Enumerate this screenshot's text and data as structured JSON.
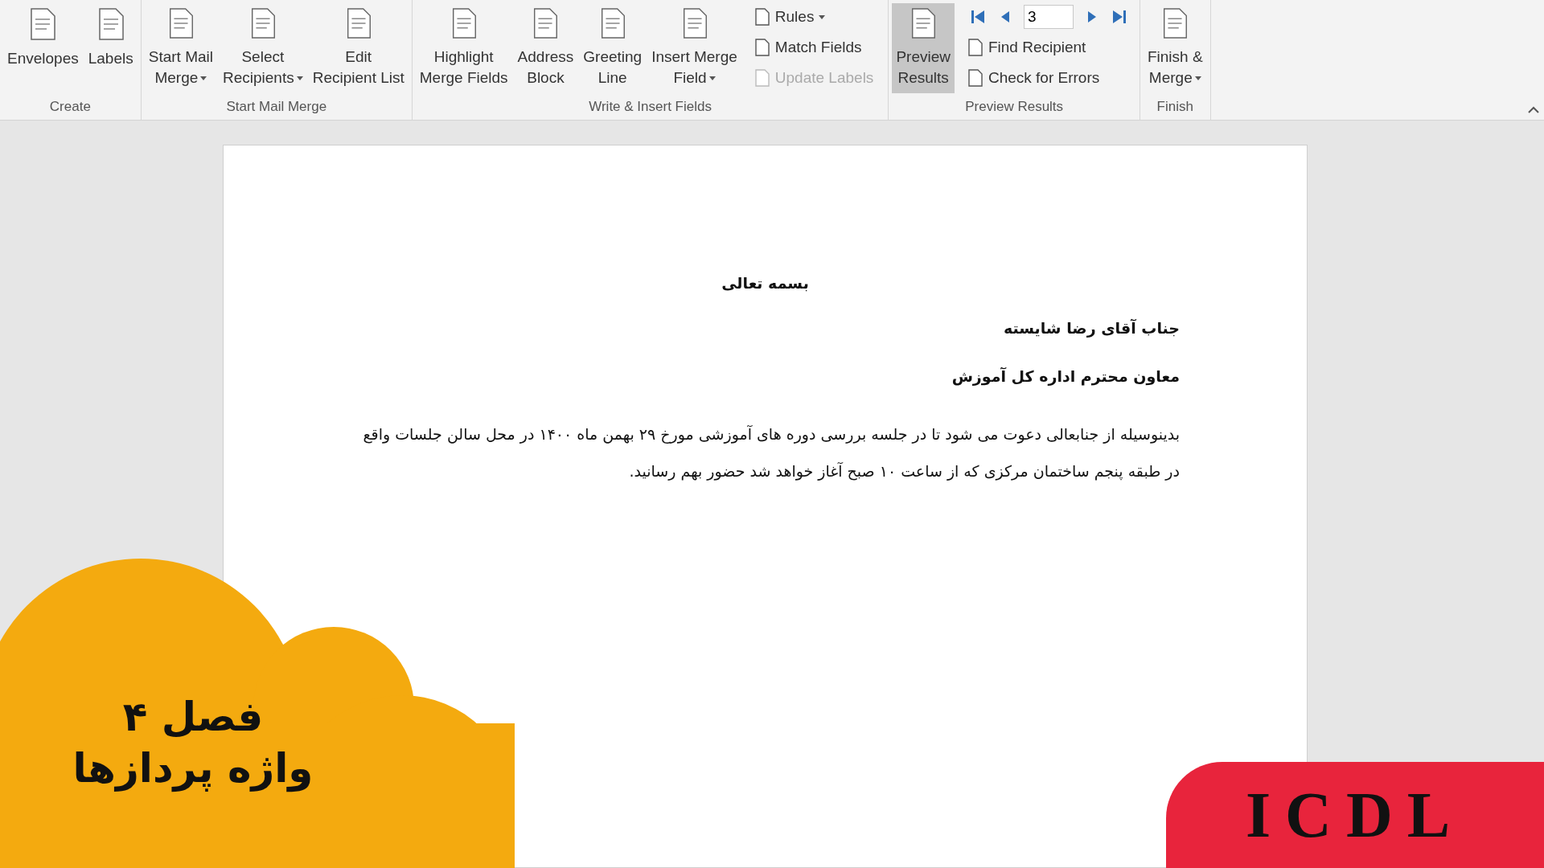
{
  "ribbon": {
    "groups": [
      {
        "label": "Create",
        "items": [
          {
            "kind": "large",
            "lines": [
              "Envelopes"
            ],
            "dropdown": false,
            "on": false
          },
          {
            "kind": "large",
            "lines": [
              "Labels"
            ],
            "dropdown": false,
            "on": false
          }
        ]
      },
      {
        "label": "Start Mail Merge",
        "items": [
          {
            "kind": "large",
            "lines": [
              "Start Mail",
              "Merge"
            ],
            "dropdown": true,
            "on": false
          },
          {
            "kind": "large",
            "lines": [
              "Select",
              "Recipients"
            ],
            "dropdown": true,
            "on": false
          },
          {
            "kind": "large",
            "lines": [
              "Edit",
              "Recipient List"
            ],
            "dropdown": false,
            "on": false
          }
        ]
      },
      {
        "label": "Write & Insert Fields",
        "items": [
          {
            "kind": "large",
            "lines": [
              "Highlight",
              "Merge Fields"
            ],
            "dropdown": false,
            "on": false
          },
          {
            "kind": "large",
            "lines": [
              "Address",
              "Block"
            ],
            "dropdown": false,
            "on": false
          },
          {
            "kind": "large",
            "lines": [
              "Greeting",
              "Line"
            ],
            "dropdown": false,
            "on": false
          },
          {
            "kind": "large",
            "lines": [
              "Insert Merge",
              "Field"
            ],
            "dropdown": true,
            "on": false
          },
          {
            "kind": "stack",
            "rows": [
              {
                "kind": "small",
                "label": "Rules",
                "dropdown": true,
                "disabled": false
              },
              {
                "kind": "small",
                "label": "Match Fields",
                "dropdown": false,
                "disabled": false
              },
              {
                "kind": "small",
                "label": "Update Labels",
                "dropdown": false,
                "disabled": true
              }
            ]
          }
        ]
      },
      {
        "label": "Preview Results",
        "items": [
          {
            "kind": "large",
            "lines": [
              "Preview",
              "Results"
            ],
            "dropdown": false,
            "on": true
          },
          {
            "kind": "stack",
            "rows": [
              {
                "kind": "nav",
                "value": "3"
              },
              {
                "kind": "small",
                "label": "Find Recipient",
                "dropdown": false,
                "disabled": false
              },
              {
                "kind": "small",
                "label": "Check for Errors",
                "dropdown": false,
                "disabled": false
              }
            ]
          }
        ]
      },
      {
        "label": "Finish",
        "items": [
          {
            "kind": "large",
            "lines": [
              "Finish &",
              "Merge"
            ],
            "dropdown": true,
            "on": false
          }
        ]
      }
    ]
  },
  "document": {
    "heading": "بسمه تعالی",
    "lines": [
      "جناب آقای رضا  شایسته",
      "معاون  محترم اداره کل آموزش"
    ],
    "paragraph": "بدینوسیله از جنابعالی دعوت می شود تا در جلسه بررسی دوره های آموزشی مورخ ۲۹ بهمن ماه ۱۴۰۰ در محل سالن جلسات واقع در طبقه پنجم ساختمان مرکزی که از ساعت ۱۰ صبح آغاز خواهد شد حضور بهم رسانید."
  },
  "overlays": {
    "chapter_badge": {
      "lines": [
        "فصل ۴",
        "واژه پردازها"
      ]
    },
    "logo_badge": {
      "text": "ICDL"
    }
  }
}
